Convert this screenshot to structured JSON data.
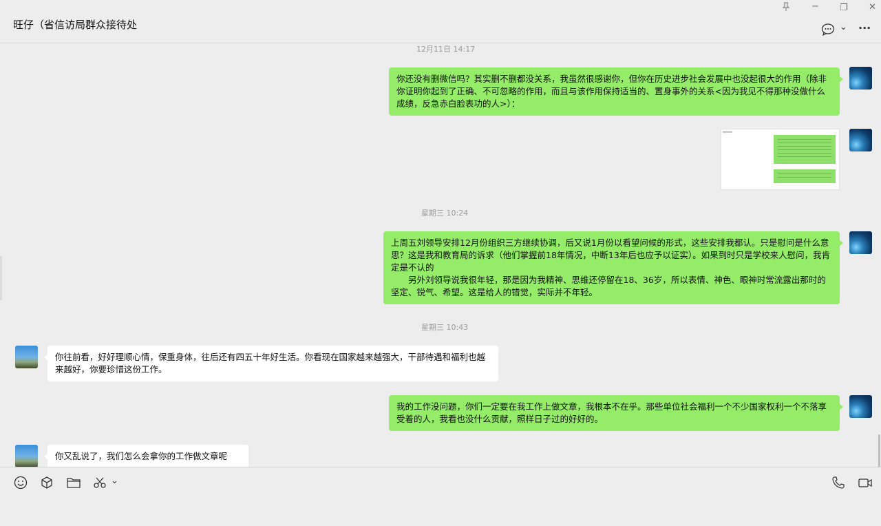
{
  "header": {
    "title": "旺仔（省信访局群众接待处",
    "pin_icon": "pin-icon",
    "minimize_glyph": "−",
    "restore_glyph": "❐",
    "close_glyph": "✕",
    "chat_info_glyph": "💬",
    "dropdown_glyph": "⌄",
    "more_glyph": "···"
  },
  "messages": [
    {
      "type": "time",
      "text": "12月11日 14:17"
    },
    {
      "type": "text",
      "sender": "self",
      "paragraphs": [
        "你还没有删微信吗？其实删不删都没关系，我虽然很感谢你，但你在历史进步社会发展中也没起很大的作用（除非你证明你起到了正确、不可忽略的作用，而且与该作用保持适当的、置身事外的关系<因为我见不得那种没做什么成绩，反急赤白脸表功的人>）："
      ]
    },
    {
      "type": "image",
      "sender": "self"
    },
    {
      "type": "time",
      "text": "星期三 10:24"
    },
    {
      "type": "text",
      "sender": "self",
      "paragraphs": [
        "上周五刘领导安排12月份组织三方继续协调，后又说1月份以看望问候的形式，这些安排我都认。只是慰问是什么意思？这是我和教育局的诉求（他们掌握前18年情况，中断13年后也应予以证实）。如果到时只是学校来人慰问，我肯定是不认的",
        "另外刘领导说我很年轻，那是因为我精神、思维还停留在18、36岁，所以表情、神色、眼神时常流露出那时的坚定、锐气、希望。这是给人的错觉，实际并不年轻。"
      ]
    },
    {
      "type": "time",
      "text": "星期三 10:43"
    },
    {
      "type": "text",
      "sender": "other",
      "paragraphs": [
        "你往前看，好好理顺心情，保重身体，往后还有四五十年好生活。你看现在国家越来越强大，干部待遇和福利也越来越好，你要珍惜这份工作。"
      ]
    },
    {
      "type": "text",
      "sender": "self",
      "paragraphs": [
        "我的工作没问题，你们一定要在我工作上做文章，我根本不在乎。那些单位社会福利一个不少国家权利一个不落享受着的人，我看也没什么贡献，照样日子过的好好的。"
      ]
    },
    {
      "type": "text",
      "sender": "other",
      "paragraphs": [
        "你又乱说了，我们怎么会拿你的工作做文章呢"
      ]
    }
  ],
  "toolbar": {
    "emoji_glyph": "☺",
    "favorites_glyph": "⬡",
    "file_glyph": "▭",
    "screenshot_glyph": "✂",
    "screenshot_dropdown_glyph": "⌄",
    "voice_call_glyph": "✆",
    "video_call_glyph": "▭"
  }
}
